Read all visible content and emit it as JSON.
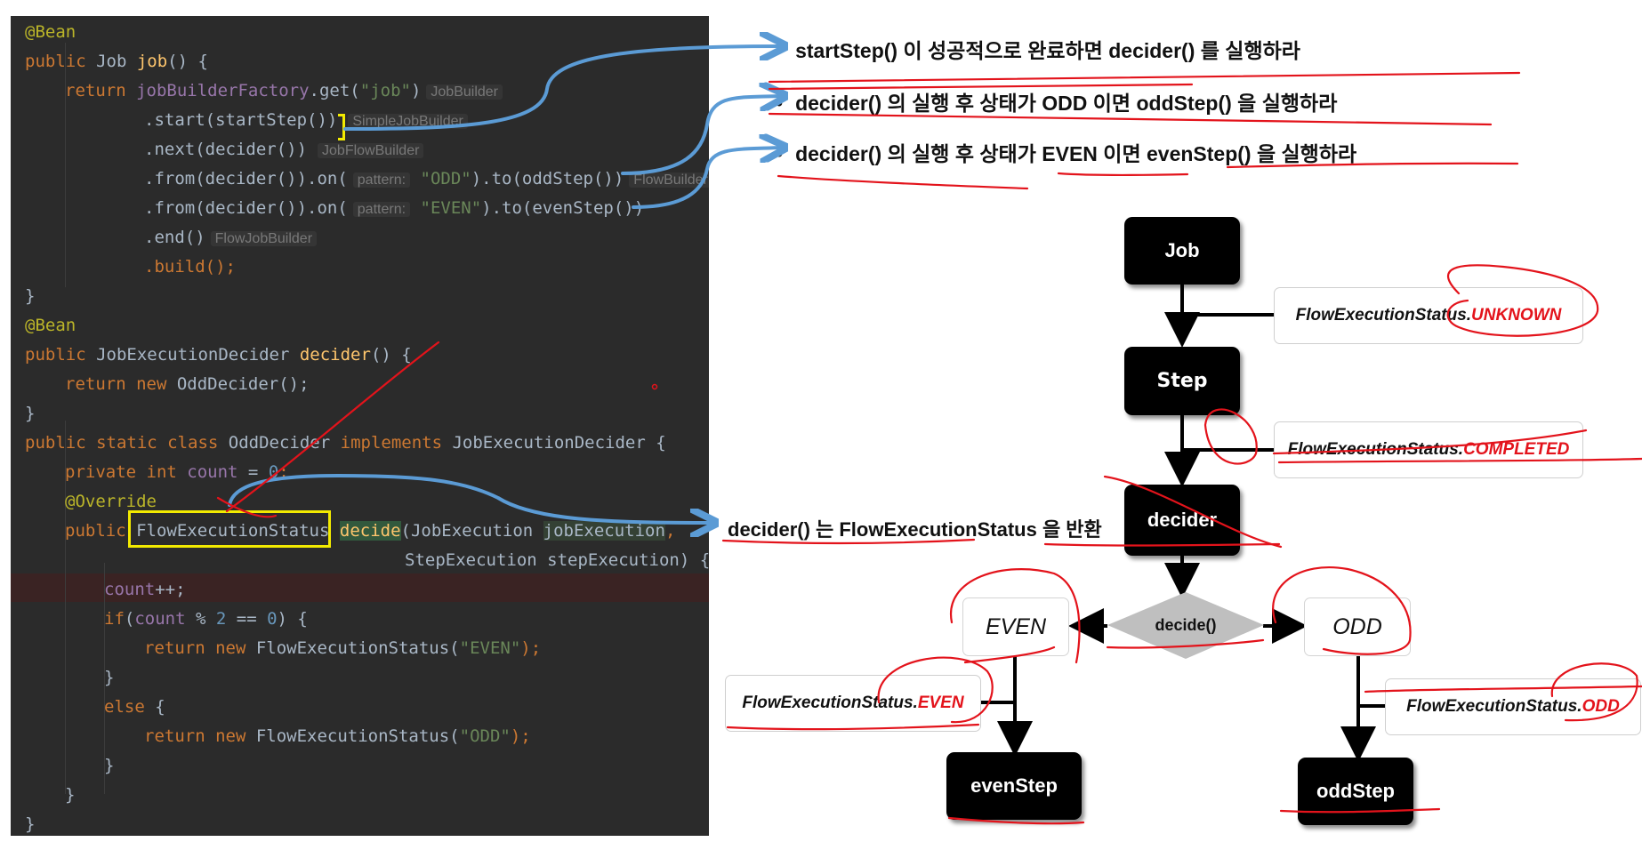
{
  "code": {
    "lines": {
      "l1": {
        "ann": "@Bean"
      },
      "l2": {
        "kw": "public ",
        "type": "Job ",
        "fn": "job",
        "rest": "() {"
      },
      "l3": {
        "kw": "return ",
        "fld": "jobBuilderFactory",
        "mid": ".get(",
        "str": "\"job\"",
        "close": ")",
        "hint": "JobBuilder"
      },
      "l4": {
        "text": ".start(startStep())",
        "hint": "SimpleJobBuilder"
      },
      "l5": {
        "text": ".next(decider())",
        "hint": "JobFlowBuilder"
      },
      "l6": {
        "pre": ".from(decider()).on(",
        "pname": "pattern:",
        "str": "\"ODD\"",
        "post": ").to(oddStep())",
        "hint": "FlowBuilder"
      },
      "l7": {
        "pre": ".from(decider()).on(",
        "pname": "pattern:",
        "str": "\"EVEN\"",
        "post": ").to(evenStep())"
      },
      "l8": {
        "text": ".end()",
        "hint": "FlowJobBuilder"
      },
      "l9": {
        "text": ".build();"
      },
      "l10": {
        "text": "}"
      },
      "l11": {
        "ann": "@Bean"
      },
      "l12": {
        "kw": "public ",
        "type": "JobExecutionDecider ",
        "fn": "decider",
        "rest": "() {"
      },
      "l13": {
        "kw": "return new ",
        "rest": "OddDecider();"
      },
      "l14": {
        "text": "}"
      },
      "l15": {
        "kw": "public static class ",
        "type": "OddDecider ",
        "kw2": "implements ",
        "rest": "JobExecutionDecider {"
      },
      "l16": {
        "kw": "private int ",
        "fld": "count",
        "mid": " = ",
        "num": "0",
        "end": ";"
      },
      "l17": {
        "ann": "@Override"
      },
      "l18": {
        "kw": "public ",
        "type": "FlowExecutionStatus",
        "sp": " ",
        "fn": "decide",
        "mid": "(JobExecution ",
        "param": "jobExecution",
        "end": ","
      },
      "l19": {
        "text": "StepExecution stepExecution) {"
      },
      "l20": {
        "fld": "count",
        "rest": "++;"
      },
      "l21": {
        "kw": "if",
        "mid": "(",
        "fld": "count",
        "mid2": " % ",
        "num": "2",
        "mid3": " == ",
        "num2": "0",
        "end": ") {"
      },
      "l22": {
        "kw": "return new ",
        "type": "FlowExecutionStatus(",
        "str": "\"EVEN\"",
        "end": ");"
      },
      "l23": {
        "text": "}"
      },
      "l24": {
        "kw": "else",
        "rest": " {"
      },
      "l25": {
        "kw": "return new ",
        "type": "FlowExecutionStatus(",
        "str": "\"ODD\"",
        "end": ");"
      },
      "l26": {
        "text": "}"
      },
      "l27": {
        "text": "}"
      },
      "l28": {
        "text": "}"
      }
    }
  },
  "bullets": [
    "startStep() 이 성공적으로 완료하면 decider() 를 실행하라",
    "decider() 의 실행 후 상태가 ODD 이면 oddStep() 을 실행하라",
    "decider() 의 실행 후 상태가 EVEN 이면 evenStep() 을 실행하라"
  ],
  "bullet_marker": "•",
  "decider_note": "decider() 는 FlowExecutionStatus 을 반환",
  "diagram": {
    "nodes": {
      "job": "Job",
      "step": "Step",
      "decider": "decider",
      "even_step": "evenStep",
      "odd_step": "oddStep"
    },
    "decision_label": "decide()",
    "branch_even": "EVEN",
    "branch_odd": "ODD",
    "status_prefix": "FlowExecutionStatus.",
    "status_unknown": "UNKNOWN",
    "status_completed": "COMPLETED",
    "status_even": "EVEN",
    "status_odd": "ODD"
  },
  "colors": {
    "editor_bg": "#2b2b2b",
    "arrow_blue": "#5b9bd5",
    "annotation_red": "#e3131b",
    "highlight_yellow": "#f2ea00",
    "node_black": "#000000",
    "diamond_gray": "#bfbfbf"
  }
}
